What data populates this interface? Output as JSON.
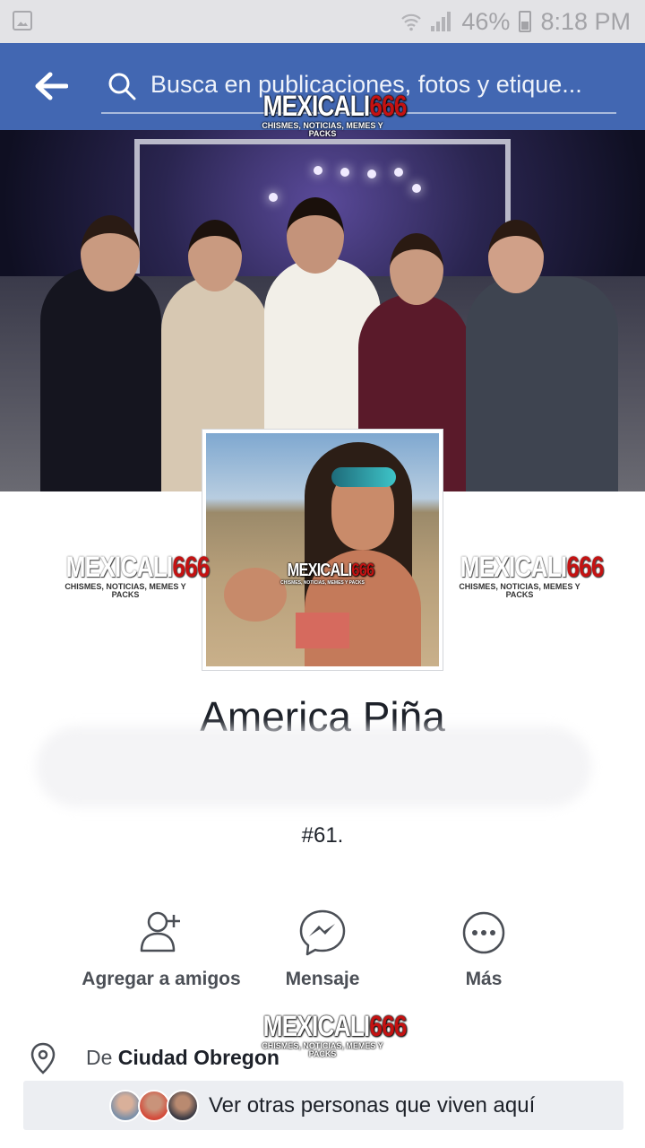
{
  "status_bar": {
    "battery_percent": "46%",
    "time": "8:18 PM"
  },
  "header": {
    "search_placeholder": "Busca en publicaciones, fotos y etique..."
  },
  "watermark": {
    "brand": "MEXICALI",
    "number": "666",
    "tagline": "CHISMES, NOTICIAS, MEMES Y PACKS"
  },
  "profile": {
    "name": "America Piña",
    "bio": "#61."
  },
  "actions": [
    {
      "label": "Agregar a amigos",
      "icon": "add-friend-icon"
    },
    {
      "label": "Mensaje",
      "icon": "messenger-icon"
    },
    {
      "label": "Más",
      "icon": "more-icon"
    }
  ],
  "info": {
    "from_prefix": "De ",
    "from_place": "Ciudad Obregon"
  },
  "others": {
    "label": "Ver otras personas que viven aquí"
  },
  "colors": {
    "brand_blue": "#4267b2",
    "watermark_red": "#c41212"
  }
}
